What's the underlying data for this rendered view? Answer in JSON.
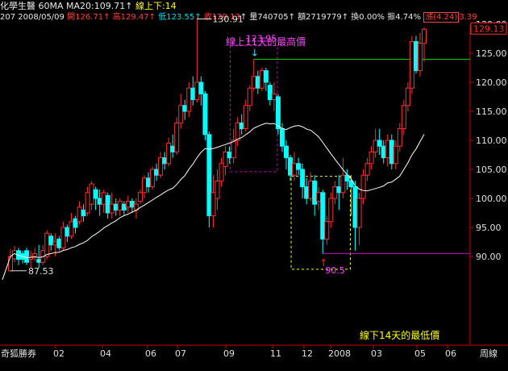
{
  "header": {
    "name": "化學生醫",
    "period": "60MA",
    "ma_label": "MA20:109.71",
    "ma_arrow": "↑",
    "line_label": "線上下:14",
    "code_date": "207 2008/05/09",
    "open": "開126.71",
    "high": "高129.47",
    "low": "低123.55",
    "close": "收129.13",
    "volume": "量740705",
    "amount": "額2719779",
    "turnover": "換0.00%",
    "amplitude": "振4.74%",
    "change": "漲(4.24)",
    "change_pct": "3.39"
  },
  "footer": {
    "source": "奇狐勝券",
    "period_button": "周線"
  },
  "annotations": {
    "top_box": "線上11天的最高價",
    "top_value": "123.95",
    "bottom_box": "線下14天的最低價",
    "bottom_value": "90.5",
    "peak_value": "130.91",
    "start_low_value": "87.53",
    "current_price": "129.13"
  },
  "colors": {
    "up": "#ff3030",
    "down": "#00ffff",
    "ma": "#ffffff",
    "high_line": "#00cc00",
    "low_line": "#cc00cc",
    "top_box": "#cc00cc",
    "bottom_box": "#ffff00",
    "axis": "#cc0000"
  },
  "chart_data": {
    "type": "candlestick",
    "ylim": [
      86,
      132
    ],
    "y_ticks": [
      90,
      95,
      100,
      105,
      110,
      115,
      120,
      125,
      130
    ],
    "x_tick_labels": [
      "02",
      "04",
      "06",
      "07",
      "09",
      "11",
      "12",
      "2008",
      "03",
      "05",
      "06"
    ],
    "horizontal_lines": [
      {
        "value": 123.95,
        "color": "green"
      },
      {
        "value": 90.5,
        "color": "magenta"
      }
    ],
    "candles": [
      [
        87.5,
        90.0,
        91.3,
        87.5
      ],
      [
        89.6,
        91.0,
        91.8,
        89.0
      ],
      [
        91.0,
        89.5,
        91.5,
        88.5
      ],
      [
        90.5,
        89.5,
        91.0,
        88.8
      ],
      [
        91.0,
        89.0,
        91.5,
        88.5
      ],
      [
        89.5,
        90.0,
        91.0,
        88.0
      ],
      [
        90.0,
        90.5,
        91.5,
        89.2
      ],
      [
        89.5,
        89.0,
        92.0,
        88.0
      ],
      [
        89.0,
        91.0,
        92.0,
        88.5
      ],
      [
        90.0,
        94.0,
        94.5,
        89.5
      ],
      [
        93.5,
        92.0,
        94.0,
        91.0
      ],
      [
        92.0,
        92.5,
        94.0,
        90.0
      ],
      [
        93.0,
        91.5,
        93.5,
        91.0
      ],
      [
        91.5,
        95.0,
        96.0,
        91.0
      ],
      [
        95.0,
        93.5,
        95.5,
        92.5
      ],
      [
        93.5,
        96.0,
        97.5,
        93.0
      ],
      [
        96.5,
        95.0,
        97.0,
        94.0
      ],
      [
        96.0,
        98.5,
        99.5,
        95.5
      ],
      [
        98.0,
        97.0,
        99.0,
        96.0
      ],
      [
        97.5,
        101.0,
        102.0,
        97.0
      ],
      [
        99.0,
        102.5,
        103.0,
        98.0
      ],
      [
        101.5,
        100.0,
        102.0,
        98.0
      ],
      [
        100.0,
        99.0,
        101.5,
        97.0
      ],
      [
        99.0,
        101.0,
        101.5,
        97.5
      ],
      [
        100.5,
        97.5,
        101.0,
        96.5
      ],
      [
        97.5,
        99.0,
        101.0,
        96.5
      ],
      [
        99.0,
        98.0,
        100.0,
        97.0
      ],
      [
        98.0,
        99.5,
        100.0,
        97.0
      ],
      [
        99.0,
        98.0,
        99.5,
        97.0
      ],
      [
        98.5,
        99.5,
        100.5,
        97.5
      ],
      [
        99.5,
        98.5,
        100.0,
        97.5
      ],
      [
        98.0,
        99.0,
        100.0,
        96.5
      ],
      [
        99.5,
        101.0,
        101.5,
        99.0
      ],
      [
        101.0,
        103.5,
        104.0,
        100.0
      ],
      [
        103.5,
        102.0,
        104.5,
        101.0
      ],
      [
        102.0,
        105.0,
        105.5,
        101.5
      ],
      [
        105.0,
        104.0,
        106.0,
        103.0
      ],
      [
        104.0,
        107.0,
        108.0,
        103.5
      ],
      [
        107.0,
        106.0,
        108.0,
        105.0
      ],
      [
        106.0,
        109.5,
        110.5,
        105.5
      ],
      [
        109.0,
        108.0,
        111.0,
        107.0
      ],
      [
        108.0,
        113.0,
        114.0,
        107.5
      ],
      [
        113.0,
        116.0,
        118.0,
        112.0
      ],
      [
        116.0,
        115.0,
        117.0,
        113.5
      ],
      [
        115.0,
        119.0,
        120.0,
        114.0
      ],
      [
        119.0,
        117.0,
        121.0,
        116.0
      ],
      [
        117.0,
        120.0,
        130.91,
        116.5
      ],
      [
        120.0,
        118.0,
        121.0,
        116.0
      ],
      [
        118.0,
        111.0,
        118.5,
        110.0
      ],
      [
        111.0,
        97.0,
        111.5,
        95.0
      ],
      [
        97.0,
        101.0,
        104.0,
        95.0
      ],
      [
        100.0,
        103.0,
        105.0,
        98.0
      ],
      [
        103.0,
        106.0,
        107.0,
        102.0
      ],
      [
        105.5,
        108.0,
        109.0,
        104.0
      ],
      [
        108.0,
        107.0,
        109.0,
        106.0
      ],
      [
        107.0,
        110.0,
        112.0,
        106.0
      ],
      [
        110.0,
        113.0,
        114.0,
        109.0
      ],
      [
        113.0,
        112.0,
        114.5,
        111.0
      ],
      [
        112.0,
        116.0,
        117.0,
        111.5
      ],
      [
        116.0,
        119.0,
        119.5,
        115.0
      ],
      [
        119.0,
        121.0,
        123.95,
        118.5
      ],
      [
        121.0,
        119.0,
        122.0,
        118.0
      ],
      [
        119.0,
        122.0,
        122.5,
        118.5
      ],
      [
        122.0,
        120.0,
        122.5,
        118.5
      ],
      [
        119.5,
        117.0,
        120.0,
        116.0
      ],
      [
        117.0,
        118.0,
        120.0,
        115.0
      ],
      [
        117.5,
        112.0,
        118.0,
        111.0
      ],
      [
        112.0,
        109.0,
        113.0,
        108.0
      ],
      [
        109.0,
        107.0,
        110.0,
        105.0
      ],
      [
        107.0,
        104.0,
        107.5,
        103.0
      ],
      [
        104.0,
        106.0,
        108.0,
        103.0
      ],
      [
        106.0,
        105.0,
        107.0,
        104.0
      ],
      [
        105.0,
        102.0,
        106.0,
        100.0
      ],
      [
        102.0,
        100.0,
        103.5,
        99.0
      ],
      [
        100.0,
        103.0,
        104.5,
        99.5
      ],
      [
        103.0,
        99.0,
        104.0,
        97.0
      ],
      [
        99.5,
        101.0,
        102.0,
        98.0
      ],
      [
        101.0,
        93.0,
        101.5,
        90.5
      ],
      [
        93.0,
        96.0,
        97.0,
        92.0
      ],
      [
        96.0,
        100.0,
        101.0,
        95.0
      ],
      [
        100.0,
        102.0,
        103.0,
        99.0
      ],
      [
        102.0,
        101.0,
        104.0,
        98.0
      ],
      [
        101.0,
        104.0,
        107.0,
        100.0
      ],
      [
        104.0,
        103.0,
        105.0,
        101.5
      ],
      [
        103.0,
        102.0,
        104.0,
        97.0
      ],
      [
        102.0,
        95.0,
        103.0,
        91.0
      ],
      [
        95.0,
        100.0,
        101.0,
        92.0
      ],
      [
        100.0,
        104.0,
        105.0,
        99.0
      ],
      [
        104.0,
        106.0,
        107.0,
        103.0
      ],
      [
        106.0,
        108.0,
        109.0,
        105.0
      ],
      [
        108.0,
        110.0,
        112.0,
        107.0
      ],
      [
        110.0,
        109.0,
        112.0,
        107.5
      ],
      [
        109.0,
        107.0,
        110.0,
        106.0
      ],
      [
        107.0,
        110.0,
        111.0,
        105.5
      ],
      [
        110.0,
        106.0,
        111.0,
        105.0
      ],
      [
        106.0,
        109.0,
        110.0,
        105.0
      ],
      [
        109.0,
        112.0,
        113.0,
        108.0
      ],
      [
        112.0,
        116.0,
        117.0,
        111.0
      ],
      [
        116.0,
        119.0,
        120.0,
        115.0
      ],
      [
        119.0,
        127.0,
        128.0,
        118.0
      ],
      [
        127.0,
        122.0,
        128.0,
        121.5
      ],
      [
        122.0,
        126.71,
        128.5,
        121.0
      ],
      [
        126.71,
        129.13,
        129.47,
        123.55
      ]
    ]
  }
}
